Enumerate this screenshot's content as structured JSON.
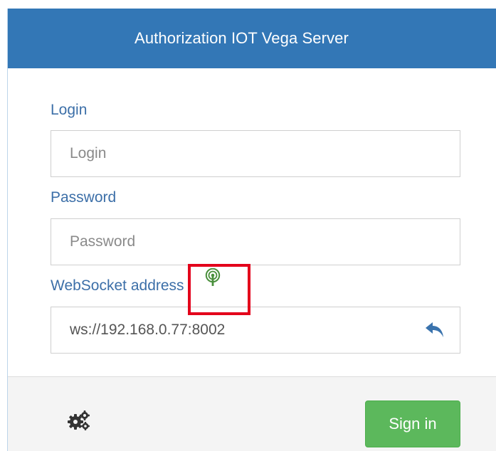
{
  "header": {
    "title": "Authorization IOT Vega Server"
  },
  "form": {
    "login_label": "Login",
    "login_placeholder": "Login",
    "login_value": "",
    "password_label": "Password",
    "password_placeholder": "Password",
    "password_value": "",
    "websocket_label": "WebSocket address",
    "websocket_value": "ws://192.168.0.77:8002"
  },
  "icons": {
    "websocket_status": "signal-tower-icon",
    "reset": "reply-arrow-icon",
    "settings": "gears-icon"
  },
  "footer": {
    "signin_label": "Sign in"
  },
  "colors": {
    "header": "#3377b6",
    "label": "#3c6fa8",
    "signin": "#5cb85c",
    "highlight": "#e3001b"
  }
}
